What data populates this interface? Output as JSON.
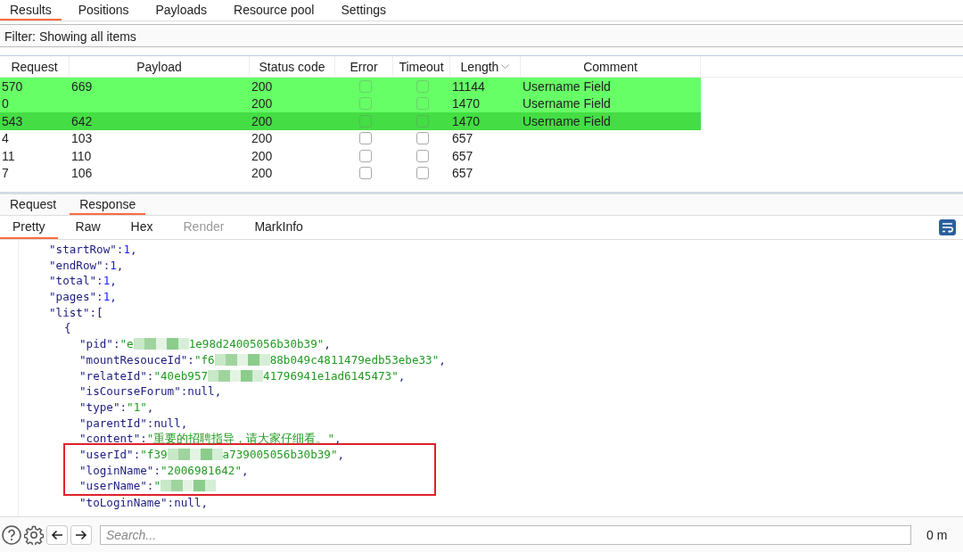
{
  "tabs": [
    {
      "label": "Results",
      "selected": true
    },
    {
      "label": "Positions",
      "selected": false
    },
    {
      "label": "Payloads",
      "selected": false
    },
    {
      "label": "Resource pool",
      "selected": false
    },
    {
      "label": "Settings",
      "selected": false
    }
  ],
  "filter": "Filter: Showing all items",
  "table": {
    "columns": [
      {
        "label": "Request",
        "kind": "text"
      },
      {
        "label": "Payload",
        "kind": "text"
      },
      {
        "label": "Status code",
        "kind": "text"
      },
      {
        "label": "Error",
        "kind": "check"
      },
      {
        "label": "Timeout",
        "kind": "check"
      },
      {
        "label": "Length",
        "kind": "text",
        "sorted": true
      },
      {
        "label": "Comment",
        "kind": "text"
      }
    ],
    "rows": [
      {
        "cells": [
          "570",
          "669",
          "200",
          false,
          false,
          "11144",
          "Username Field"
        ],
        "color": "#66ff66"
      },
      {
        "cells": [
          "0",
          "",
          "200",
          false,
          false,
          "1470",
          "Username Field"
        ],
        "color": "#66ff66"
      },
      {
        "cells": [
          "543",
          "642",
          "200",
          false,
          false,
          "1470",
          "Username Field"
        ],
        "color": "#44dd44"
      },
      {
        "cells": [
          "4",
          "103",
          "200",
          false,
          false,
          "657",
          ""
        ]
      },
      {
        "cells": [
          "11",
          "110",
          "200",
          false,
          false,
          "657",
          ""
        ]
      },
      {
        "cells": [
          "7",
          "106",
          "200",
          false,
          false,
          "657",
          ""
        ]
      }
    ]
  },
  "message_tabs": [
    {
      "label": "Request",
      "selected": false
    },
    {
      "label": "Response",
      "selected": true
    }
  ],
  "view_tabs": [
    {
      "label": "Pretty",
      "selected": true,
      "disabled": false
    },
    {
      "label": "Raw",
      "selected": false,
      "disabled": false
    },
    {
      "label": "Hex",
      "selected": false,
      "disabled": false
    },
    {
      "label": "Render",
      "selected": false,
      "disabled": true
    },
    {
      "label": "MarkInfo",
      "selected": false,
      "disabled": false
    }
  ],
  "code": [
    {
      "key": "\"startRow\":",
      "value": [
        {
          "kind": "number",
          "text": "1"
        }
      ],
      "tail": ","
    },
    {
      "key": "\"endRow\":",
      "value": [
        {
          "kind": "number",
          "text": "1"
        }
      ],
      "tail": ","
    },
    {
      "key": "\"total\":",
      "value": [
        {
          "kind": "number",
          "text": "1"
        }
      ],
      "tail": ","
    },
    {
      "key": "\"pages\":",
      "value": [
        {
          "kind": "number",
          "text": "1"
        }
      ],
      "tail": ","
    },
    {
      "key": "\"list\":",
      "value": [
        {
          "kind": "punct",
          "text": "["
        }
      ],
      "children": [
        {
          "key": "{",
          "children": [
            {
              "key": "\"pid\":",
              "value": [
                {
                  "kind": "string",
                  "text": "\"e"
                },
                {
                  "kind": "redacted"
                },
                {
                  "kind": "string",
                  "text": "1e98d24005056b30b39\""
                }
              ],
              "tail": ",",
              "boxed": false
            },
            {
              "key": "\"mountResouceId\":",
              "value": [
                {
                  "kind": "string",
                  "text": "\"f6"
                },
                {
                  "kind": "redacted"
                },
                {
                  "kind": "string",
                  "text": "88b049c4811479edb53ebe33\""
                }
              ],
              "tail": ",",
              "boxed": false
            },
            {
              "key": "\"relateId\":",
              "value": [
                {
                  "kind": "string",
                  "text": "\"40eb957"
                },
                {
                  "kind": "redacted"
                },
                {
                  "kind": "string",
                  "text": "41796941e1ad6145473\""
                }
              ],
              "tail": ",",
              "boxed": false
            },
            {
              "key": "\"isCourseForum\":",
              "value": [
                {
                  "kind": "null",
                  "text": "null"
                }
              ],
              "tail": ",",
              "boxed": false
            },
            {
              "key": "\"type\":",
              "value": [
                {
                  "kind": "string",
                  "text": "\"1\""
                }
              ],
              "tail": ",",
              "boxed": false
            },
            {
              "key": "\"parentId\":",
              "value": [
                {
                  "kind": "null",
                  "text": "null"
                }
              ],
              "tail": ",",
              "boxed": false
            },
            {
              "key": "\"content\":",
              "value": [
                {
                  "kind": "string",
                  "text": "\"重要的招聘指导，请大家仔细看。\""
                }
              ],
              "tail": ",",
              "boxed": false
            },
            {
              "key": "\"userId\":",
              "value": [
                {
                  "kind": "string",
                  "text": "\"f39"
                },
                {
                  "kind": "redacted"
                },
                {
                  "kind": "string",
                  "text": "a739005056b30b39\""
                }
              ],
              "tail": ",",
              "boxed": true
            },
            {
              "key": "\"loginName\":",
              "value": [
                {
                  "kind": "string",
                  "text": "\"2006981642\""
                }
              ],
              "tail": ",",
              "boxed": true
            },
            {
              "key": "\"userName\":",
              "value": [
                {
                  "kind": "string",
                  "text": "\""
                },
                {
                  "kind": "redacted"
                }
              ],
              "boxed": true
            },
            {
              "key": "\"toLoginName\":",
              "value": [
                {
                  "kind": "null",
                  "text": "null"
                }
              ],
              "tail": ",",
              "boxed": false
            }
          ]
        }
      ]
    }
  ],
  "search": {
    "placeholder": "Search..."
  },
  "status": "0 m"
}
